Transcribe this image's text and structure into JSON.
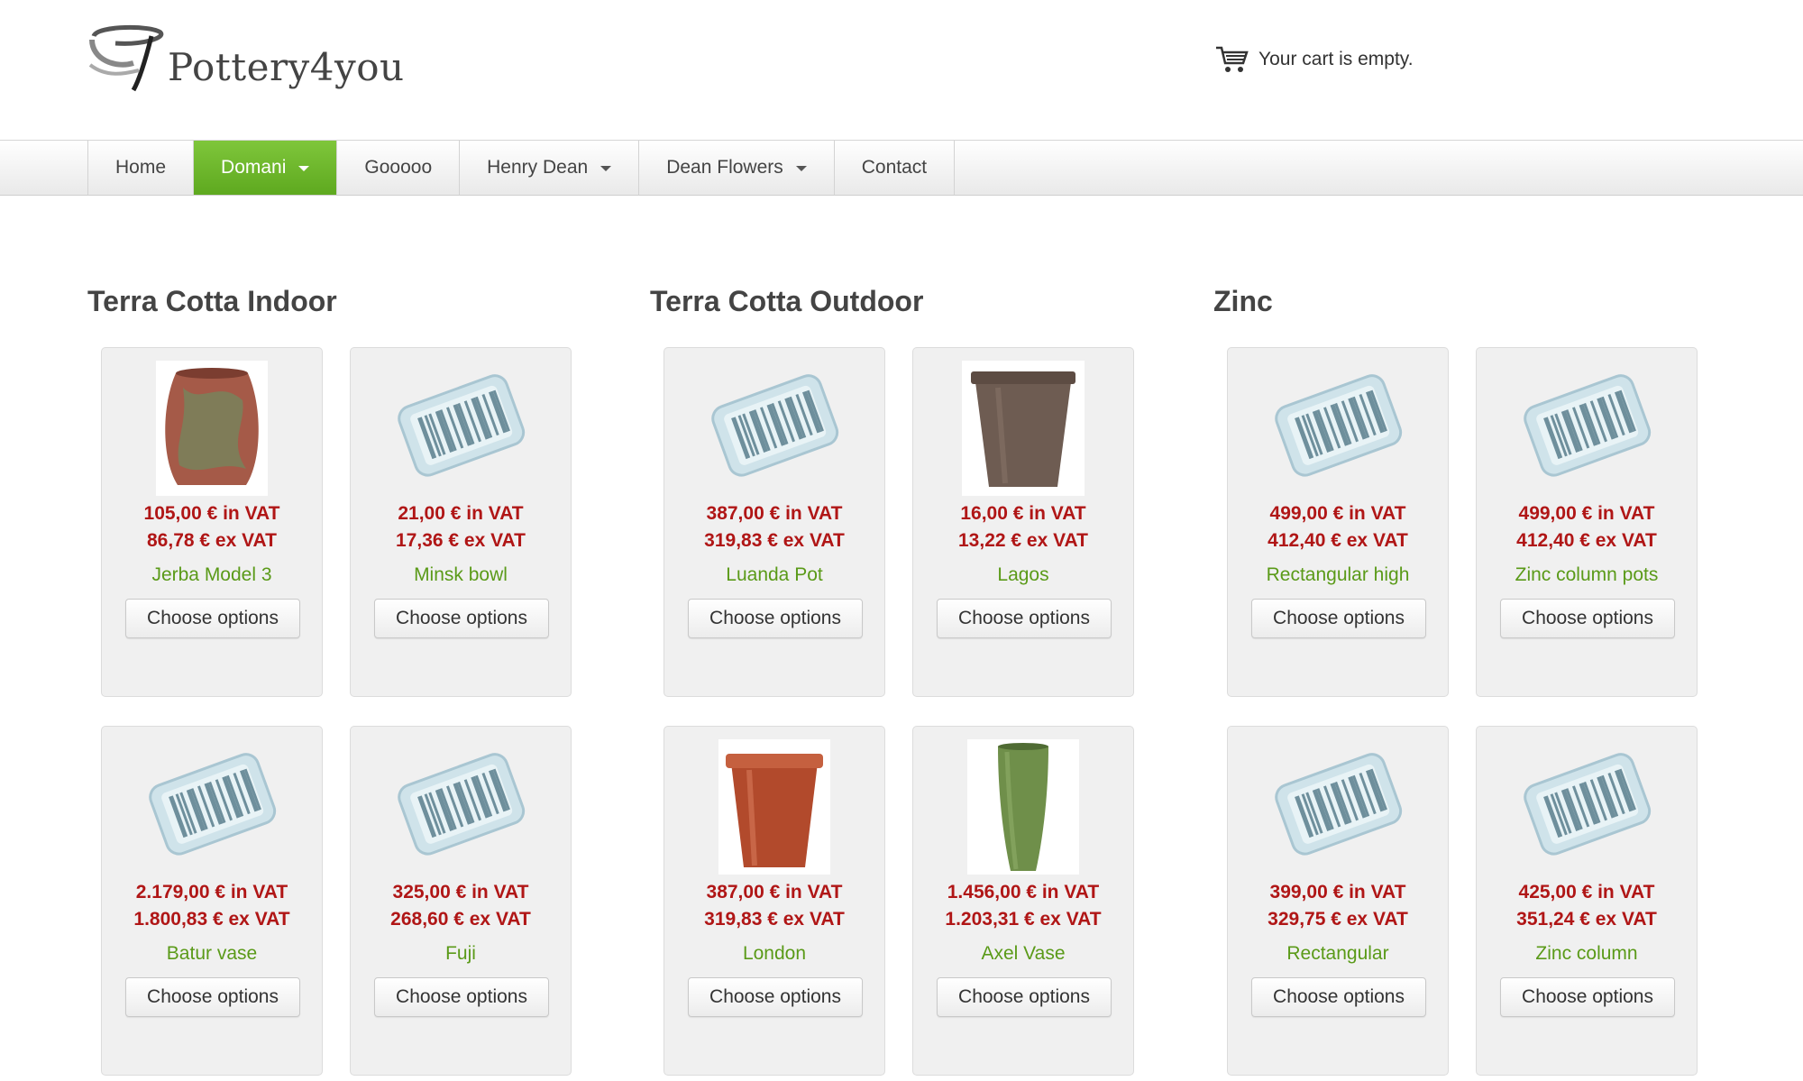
{
  "site": {
    "logo_text": "Pottery4you"
  },
  "cart": {
    "status": "Your cart is empty."
  },
  "nav": {
    "items": [
      {
        "label": "Home"
      },
      {
        "label": "Domani"
      },
      {
        "label": "Gooooo"
      },
      {
        "label": "Henry Dean"
      },
      {
        "label": "Dean Flowers"
      },
      {
        "label": "Contact"
      }
    ],
    "active": "Domani"
  },
  "colors": {
    "accent": "#6bb82a",
    "price": "#b01616",
    "product_name": "#5a9a18",
    "card_bg": "#f0f0f0"
  },
  "categories": [
    {
      "title": "Terra Cotta Indoor",
      "products": [
        {
          "name": "Jerba Model 3",
          "price_in": "105,00 € in VAT",
          "price_ex": "86,78 € ex VAT",
          "image": "jerba-pot-photo",
          "button": "Choose options"
        },
        {
          "name": "Minsk bowl",
          "price_in": "21,00 € in VAT",
          "price_ex": "17,36 € ex VAT",
          "image": "barcode-placeholder",
          "button": "Choose options"
        },
        {
          "name": "Batur vase",
          "price_in": "2.179,00 € in VAT",
          "price_ex": "1.800,83 € ex VAT",
          "image": "barcode-placeholder",
          "button": "Choose options"
        },
        {
          "name": "Fuji",
          "price_in": "325,00 € in VAT",
          "price_ex": "268,60 € ex VAT",
          "image": "barcode-placeholder",
          "button": "Choose options"
        }
      ]
    },
    {
      "title": "Terra Cotta Outdoor",
      "products": [
        {
          "name": "Luanda Pot",
          "price_in": "387,00 € in VAT",
          "price_ex": "319,83 € ex VAT",
          "image": "barcode-placeholder",
          "button": "Choose options"
        },
        {
          "name": "Lagos",
          "price_in": "16,00 € in VAT",
          "price_ex": "13,22 € ex VAT",
          "image": "lagos-pot-photo",
          "button": "Choose options"
        },
        {
          "name": "London",
          "price_in": "387,00 € in VAT",
          "price_ex": "319,83 € ex VAT",
          "image": "london-pot-photo",
          "button": "Choose options"
        },
        {
          "name": "Axel Vase",
          "price_in": "1.456,00 € in VAT",
          "price_ex": "1.203,31 € ex VAT",
          "image": "axel-vase-photo",
          "button": "Choose options"
        }
      ]
    },
    {
      "title": "Zinc",
      "products": [
        {
          "name": "Rectangular high",
          "price_in": "499,00 € in VAT",
          "price_ex": "412,40 € ex VAT",
          "image": "barcode-placeholder",
          "button": "Choose options"
        },
        {
          "name": "Zinc column pots",
          "price_in": "499,00 € in VAT",
          "price_ex": "412,40 € ex VAT",
          "image": "barcode-placeholder",
          "button": "Choose options"
        },
        {
          "name": "Rectangular",
          "price_in": "399,00 € in VAT",
          "price_ex": "329,75 € ex VAT",
          "image": "barcode-placeholder",
          "button": "Choose options"
        },
        {
          "name": "Zinc column",
          "price_in": "425,00 € in VAT",
          "price_ex": "351,24 € ex VAT",
          "image": "barcode-placeholder",
          "button": "Choose options"
        }
      ]
    }
  ]
}
